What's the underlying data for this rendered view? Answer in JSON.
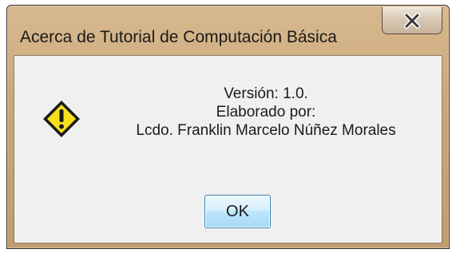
{
  "window": {
    "title": "Acerca de Tutorial de Computación Básica"
  },
  "titlebar": {
    "close_icon": "close-x-icon"
  },
  "dialog": {
    "icon": "warning-icon",
    "lines": [
      "Versión: 1.0.",
      "Elaborado por:",
      "Lcdo. Franklin Marcelo Núñez Morales"
    ],
    "ok_label": "OK"
  },
  "colors": {
    "frame": "#caa87a",
    "content_bg": "#f0f0f0",
    "warning_fill": "#f7e01a",
    "ok_border": "#3c7fb1"
  }
}
